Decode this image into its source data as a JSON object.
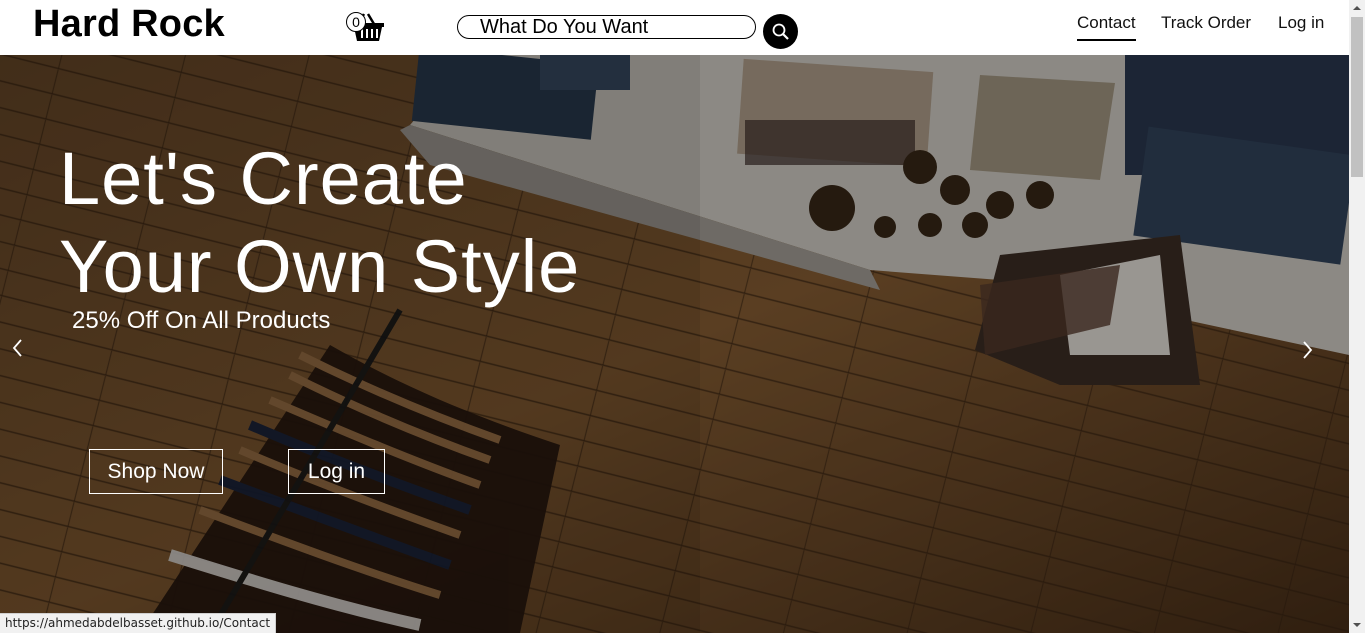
{
  "header": {
    "brand": "Hard Rock",
    "cart_count": "0",
    "search": {
      "value": "What Do You Want"
    },
    "nav": [
      {
        "label": "Contact",
        "active": true
      },
      {
        "label": "Track Order"
      },
      {
        "label": "Log in"
      }
    ]
  },
  "hero": {
    "title_line1": "Let's Create",
    "title_line2": "Your Own Style",
    "subtitle": "25% Off On All Products",
    "buttons": {
      "shop_now": "Shop Now",
      "login": "Log in"
    }
  },
  "status_bar": {
    "url": "https://ahmedabdelbasset.github.io/Contact"
  },
  "icons": {
    "cart": "shopping-basket-icon",
    "search": "magnifier-icon",
    "prev": "chevron-left-icon",
    "next": "chevron-right-icon"
  },
  "colors": {
    "brand": "#000000",
    "hero_text": "#ffffff",
    "wood": "#6b4a2a"
  }
}
